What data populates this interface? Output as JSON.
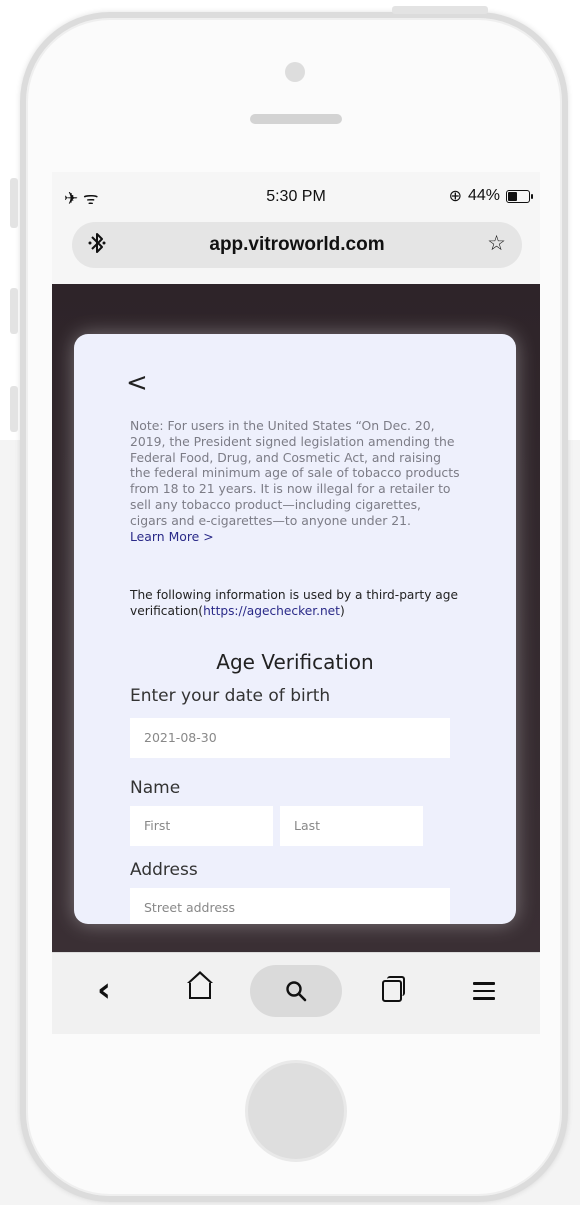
{
  "status_bar": {
    "left_icons": "✈ ᯤ",
    "time": "5:30 PM",
    "battery_percent": "44%",
    "rotation_lock_icon": "⊕"
  },
  "browser": {
    "url": "app.vitroworld.com",
    "left_icon": "bluetooth-icon",
    "right_icon": "star-icon"
  },
  "page": {
    "back_label": "<",
    "note": "Note: For users in the United States “On Dec. 20, 2019, the President signed legislation amending the Federal Food, Drug, and Cosmetic Act, and raising the federal minimum age of sale of tobacco products from 18 to 21 years. It is now illegal for a retailer to sell any tobacco product—including cigarettes, cigars and e-cigarettes—to anyone under 21.",
    "learn_more": "Learn More >",
    "third_party_prefix": "The following information is used by a third-party age verification(",
    "third_party_link": "https://agechecker.net",
    "third_party_suffix": ")",
    "section_title": "Age Verification",
    "dob_label": "Enter your date of birth",
    "dob_placeholder": "2021-08-30",
    "name_label": "Name",
    "first_placeholder": "First",
    "last_placeholder": "Last",
    "address_label": "Address",
    "street_placeholder": "Street address"
  },
  "toolbar": {
    "back": "‹",
    "home": "home-icon",
    "search": "search-icon",
    "tabs": "tabs-icon",
    "menu": "menu-icon"
  }
}
